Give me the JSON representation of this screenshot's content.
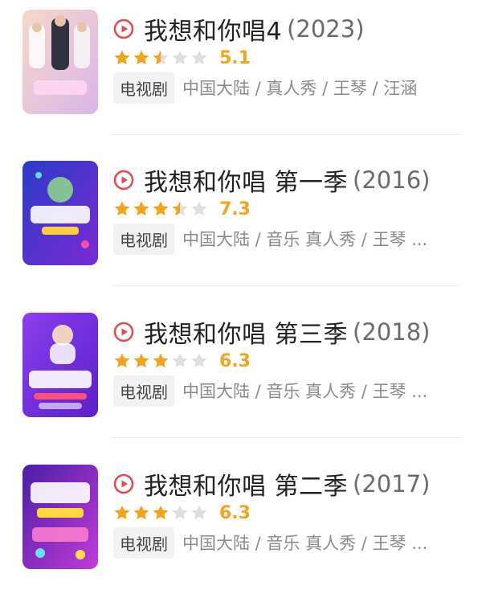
{
  "items": [
    {
      "title": "我想和你唱4",
      "year": "(2023)",
      "rating": 2.5,
      "score": "5.1",
      "tag": "电视剧",
      "info": "中国大陆 / 真人秀 / 王琴 / 汪涵",
      "poster_colors": [
        "#f6d7c9",
        "#d9b6e8"
      ]
    },
    {
      "title": "我想和你唱 第一季",
      "year": "(2016)",
      "rating": 3.5,
      "score": "7.3",
      "tag": "电视剧",
      "info": "中国大陆 / 音乐 真人秀 / 王琴 ...",
      "poster_colors": [
        "#2b3cc6",
        "#7a2ad6"
      ]
    },
    {
      "title": "我想和你唱 第三季",
      "year": "(2018)",
      "rating": 3,
      "score": "6.3",
      "tag": "电视剧",
      "info": "中国大陆 / 音乐 真人秀 / 王琴 ...",
      "poster_colors": [
        "#8a3ff0",
        "#5b20c9"
      ]
    },
    {
      "title": "我想和你唱 第二季",
      "year": "(2017)",
      "rating": 3,
      "score": "6.3",
      "tag": "电视剧",
      "info": "中国大陆 / 音乐 真人秀 / 王琴 ...",
      "poster_colors": [
        "#4a1fa8",
        "#c23bd6"
      ]
    }
  ],
  "colors": {
    "play_icon": "#e5484d",
    "star_on": "#f2a41b",
    "star_off": "#dedede",
    "score": "#f2a41b"
  }
}
